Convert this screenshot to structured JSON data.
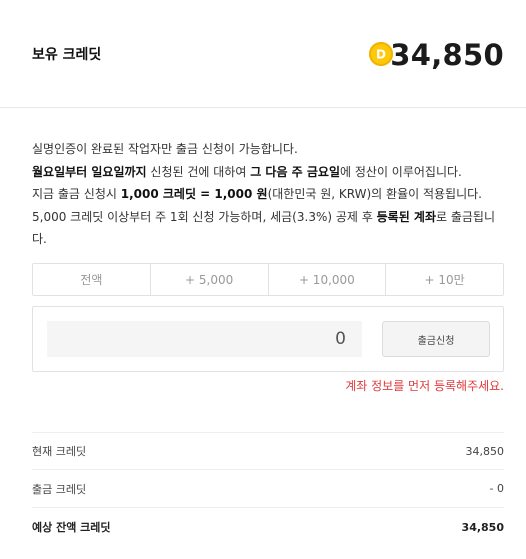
{
  "header": {
    "title": "보유 크레딧",
    "balance": "34,850",
    "coin_icon": "coin-d-icon",
    "coin_color": "#ffc80a"
  },
  "notice": {
    "line1": "실명인증이 완료된 작업자만 출금 신청이 가능합니다.",
    "line2_b1": "월요일부터 일요일까지",
    "line2_t1": " 신청된 건에 대하여 ",
    "line2_b2": "그 다음 주 금요일",
    "line2_t2": "에 정산이 이루어집니다.",
    "line3_t1": "지금 출금 신청시 ",
    "line3_b1": "1,000 크레딧 = 1,000 원",
    "line3_t2": "(대한민국 원, KRW)의 환율이 적용됩니다.",
    "line4_t1": "5,000 크레딧 이상부터 주 1회 신청 가능하며, 세금(3.3%) 공제 후 ",
    "line4_b1": "등록된 계좌",
    "line4_t2": "로 출금됩니다."
  },
  "quick_amounts": [
    "전액",
    "+ 5,000",
    "+ 10,000",
    "+ 10만"
  ],
  "amount": {
    "value": "0",
    "button_label": "출금신청"
  },
  "error": {
    "text": "계좌 정보를 먼저 등록해주세요.",
    "color": "#e03a3a"
  },
  "summary": {
    "current_label": "현재 크레딧",
    "current_value": "34,850",
    "withdraw_label": "출금 크레딧",
    "withdraw_value": "- 0",
    "expected_label": "예상 잔액 크레딧",
    "expected_value": "34,850"
  }
}
